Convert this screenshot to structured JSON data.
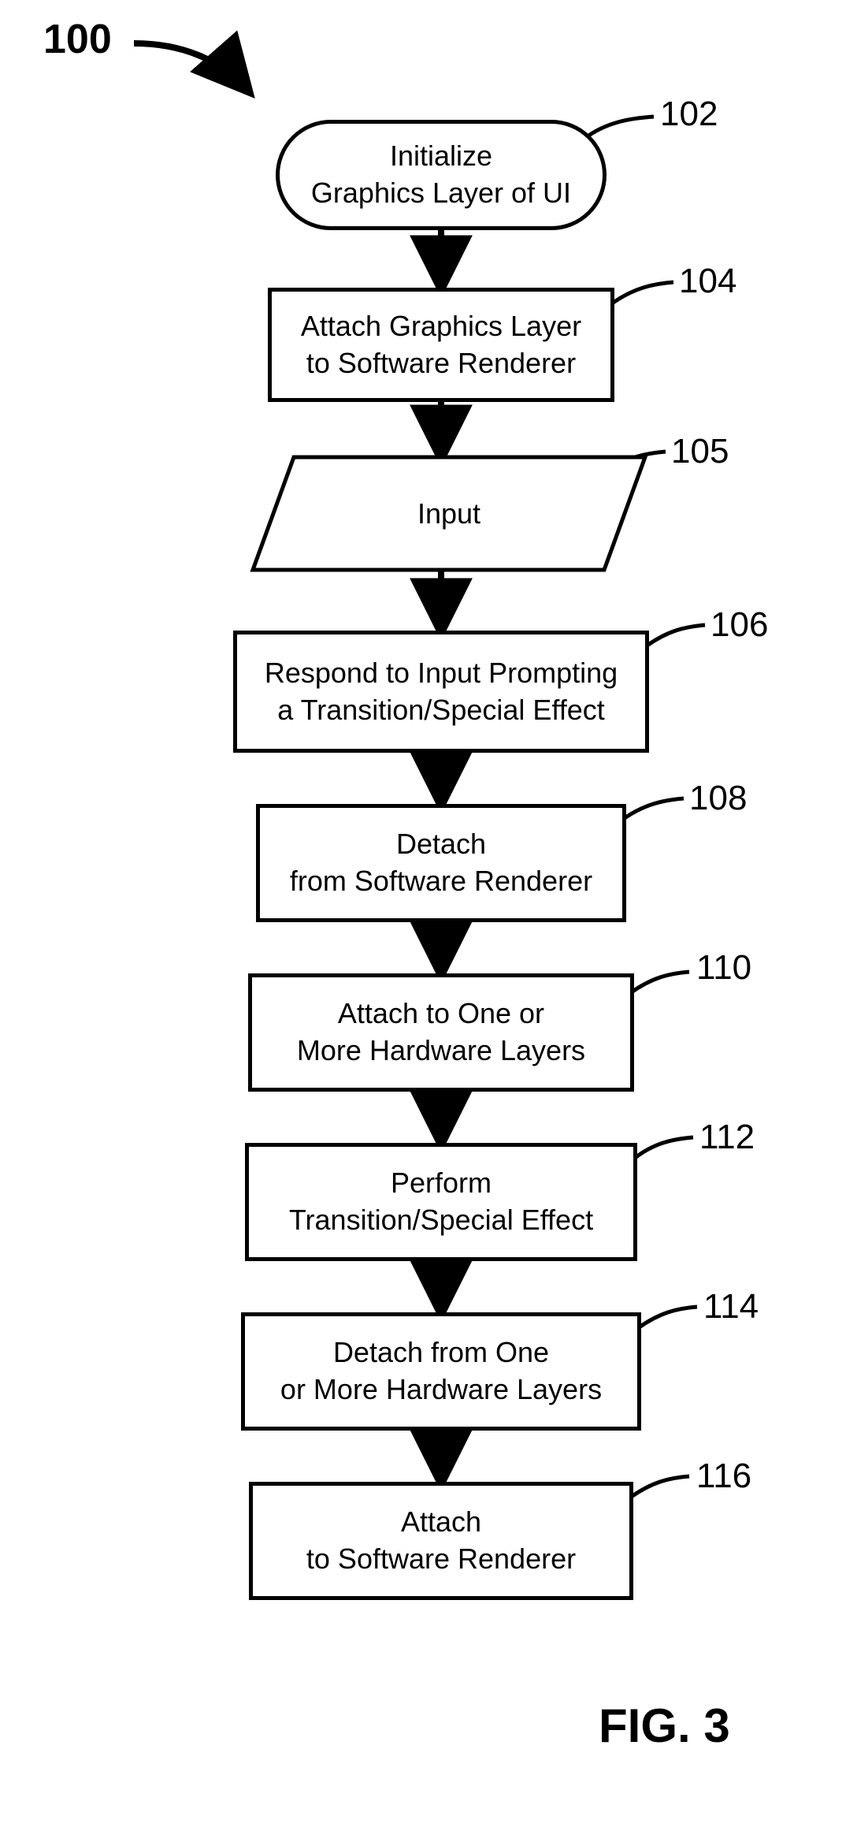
{
  "start_ref": "100",
  "fig": "FIG. 3",
  "steps": {
    "n102": {
      "ref": "102",
      "text": "Initialize\nGraphics Layer of UI"
    },
    "n104": {
      "ref": "104",
      "text": "Attach Graphics Layer\nto Software Renderer"
    },
    "n105": {
      "ref": "105",
      "text": "Input"
    },
    "n106": {
      "ref": "106",
      "text": "Respond to Input Prompting\na Transition/Special Effect"
    },
    "n108": {
      "ref": "108",
      "text": "Detach\nfrom Software Renderer"
    },
    "n110": {
      "ref": "110",
      "text": "Attach to One or\nMore Hardware Layers"
    },
    "n112": {
      "ref": "112",
      "text": "Perform\nTransition/Special Effect"
    },
    "n114": {
      "ref": "114",
      "text": "Detach from One\nor More Hardware Layers"
    },
    "n116": {
      "ref": "116",
      "text": "Attach\nto Software Renderer"
    }
  }
}
